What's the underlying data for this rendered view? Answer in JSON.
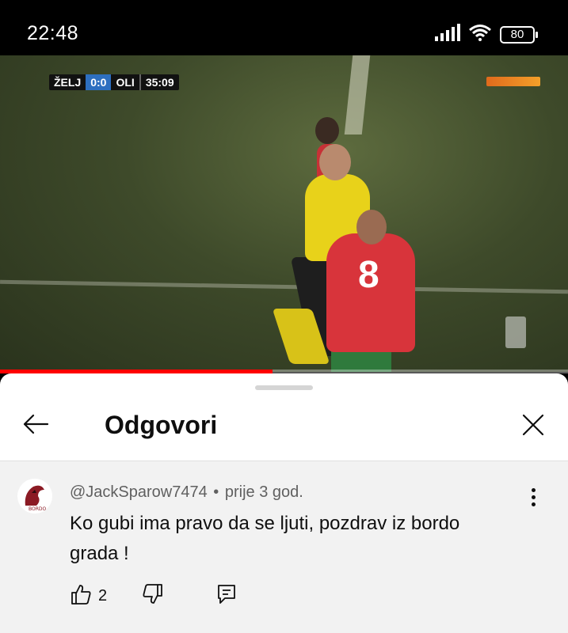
{
  "status_bar": {
    "time": "22:48",
    "battery": "80",
    "icons": [
      "signal-icon",
      "wifi-icon",
      "battery-icon"
    ]
  },
  "video": {
    "scoreboard": {
      "home_team": "ŽELJ",
      "score": "0:0",
      "away_team": "OLI",
      "clock": "35:09"
    },
    "player_number": "8",
    "progress": 0.48,
    "progress_color": "#ff0000"
  },
  "sheet": {
    "title": "Odgovori",
    "back_icon": "arrow-left-icon",
    "close_icon": "close-icon"
  },
  "comment": {
    "author": "@JackSparow7474",
    "separator": "•",
    "time_ago": "prije 3 god.",
    "text": "Ko gubi ima pravo da se ljuti, pozdrav iz bordo grada !",
    "likes": "2",
    "avatar_color": "#8b1a24",
    "icons": [
      "thumbs-up-icon",
      "thumbs-down-icon",
      "reply-icon",
      "more-vertical-icon"
    ]
  }
}
